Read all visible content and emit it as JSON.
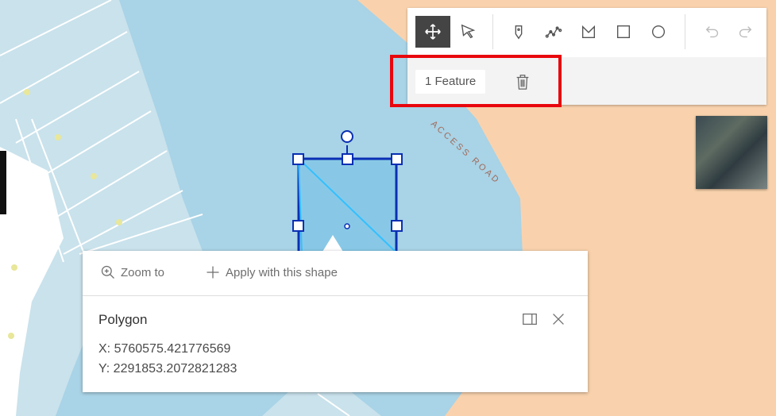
{
  "map": {
    "road_label": "ACCESS ROAD",
    "colors": {
      "water": "#a9d3e6",
      "land": "#f9d2ad",
      "parcels": "#c9e2ec",
      "selection": "#0a2fb3"
    }
  },
  "toolbar": {
    "tools": [
      {
        "name": "move-tool",
        "icon": "move-icon",
        "active": true
      },
      {
        "name": "select-tool",
        "icon": "cursor-arrow-icon",
        "active": false
      },
      {
        "name": "point-tool",
        "icon": "point-pin-icon",
        "active": false
      },
      {
        "name": "polyline-tool",
        "icon": "polyline-icon",
        "active": false
      },
      {
        "name": "polygon-tool",
        "icon": "polygon-icon",
        "active": false
      },
      {
        "name": "rectangle-tool",
        "icon": "rectangle-icon",
        "active": false
      },
      {
        "name": "circle-tool",
        "icon": "circle-icon",
        "active": false
      },
      {
        "name": "undo",
        "icon": "undo-icon",
        "active": false
      },
      {
        "name": "redo",
        "icon": "redo-icon",
        "active": false
      }
    ],
    "feature_count": "1 Feature"
  },
  "popup": {
    "zoom_label": "Zoom to",
    "apply_label": "Apply with this shape",
    "title": "Polygon",
    "x": "X: 5760575.421776569",
    "y": "Y: 2291853.2072821283"
  }
}
